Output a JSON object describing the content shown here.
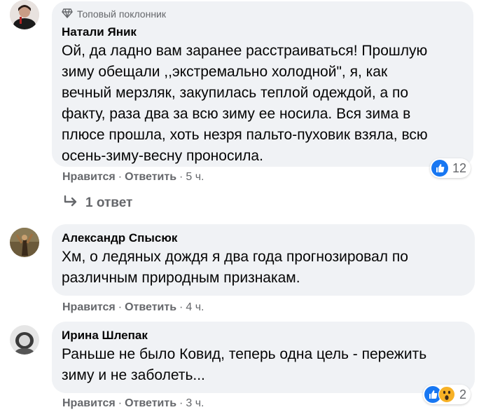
{
  "comments": [
    {
      "badge": "Топовый поклонник",
      "author": "Натали Яник",
      "lines": [
        "Ой, да ладно вам заранее расстраиваться! Прошлую",
        "зиму обещали ,,экстремально холодной\", я, как",
        "вечный мерзляк, закупилась теплой одеждой, а по",
        "факту, раза два за всю зиму ее носила. Вся зима в",
        "плюсе прошла, хоть незря пальто-пуховик взяла, всю",
        "осень-зиму-весну проносила."
      ],
      "like_label": "Нравится",
      "reply_label": "Ответить",
      "time": "5 ч.",
      "reaction_count": "12"
    },
    {
      "author": "Александр Спысюк",
      "lines": [
        "Хм, о ледяных дождя я два года прогнозировал по",
        "различным природным признакам."
      ],
      "like_label": "Нравится",
      "reply_label": "Ответить",
      "time": "4 ч."
    },
    {
      "author": "Ирина Шлепак",
      "lines": [
        "Раньше не было Ковид, теперь одна цель - пережить",
        "зиму и не заболеть..."
      ],
      "like_label": "Нравится",
      "reply_label": "Ответить",
      "time": "3 ч.",
      "reaction_count": "2"
    }
  ],
  "replies_link": "1 ответ",
  "colors": {
    "bubble": "#f0f2f5",
    "meta": "#65676b",
    "like_blue": "#1877f2",
    "wow_yellow": "#f7b125"
  },
  "icons": {
    "badge": "diamond-icon",
    "reply_arrow": "reply-arrow-icon",
    "like": "like-reaction-icon",
    "wow": "wow-reaction-icon"
  }
}
